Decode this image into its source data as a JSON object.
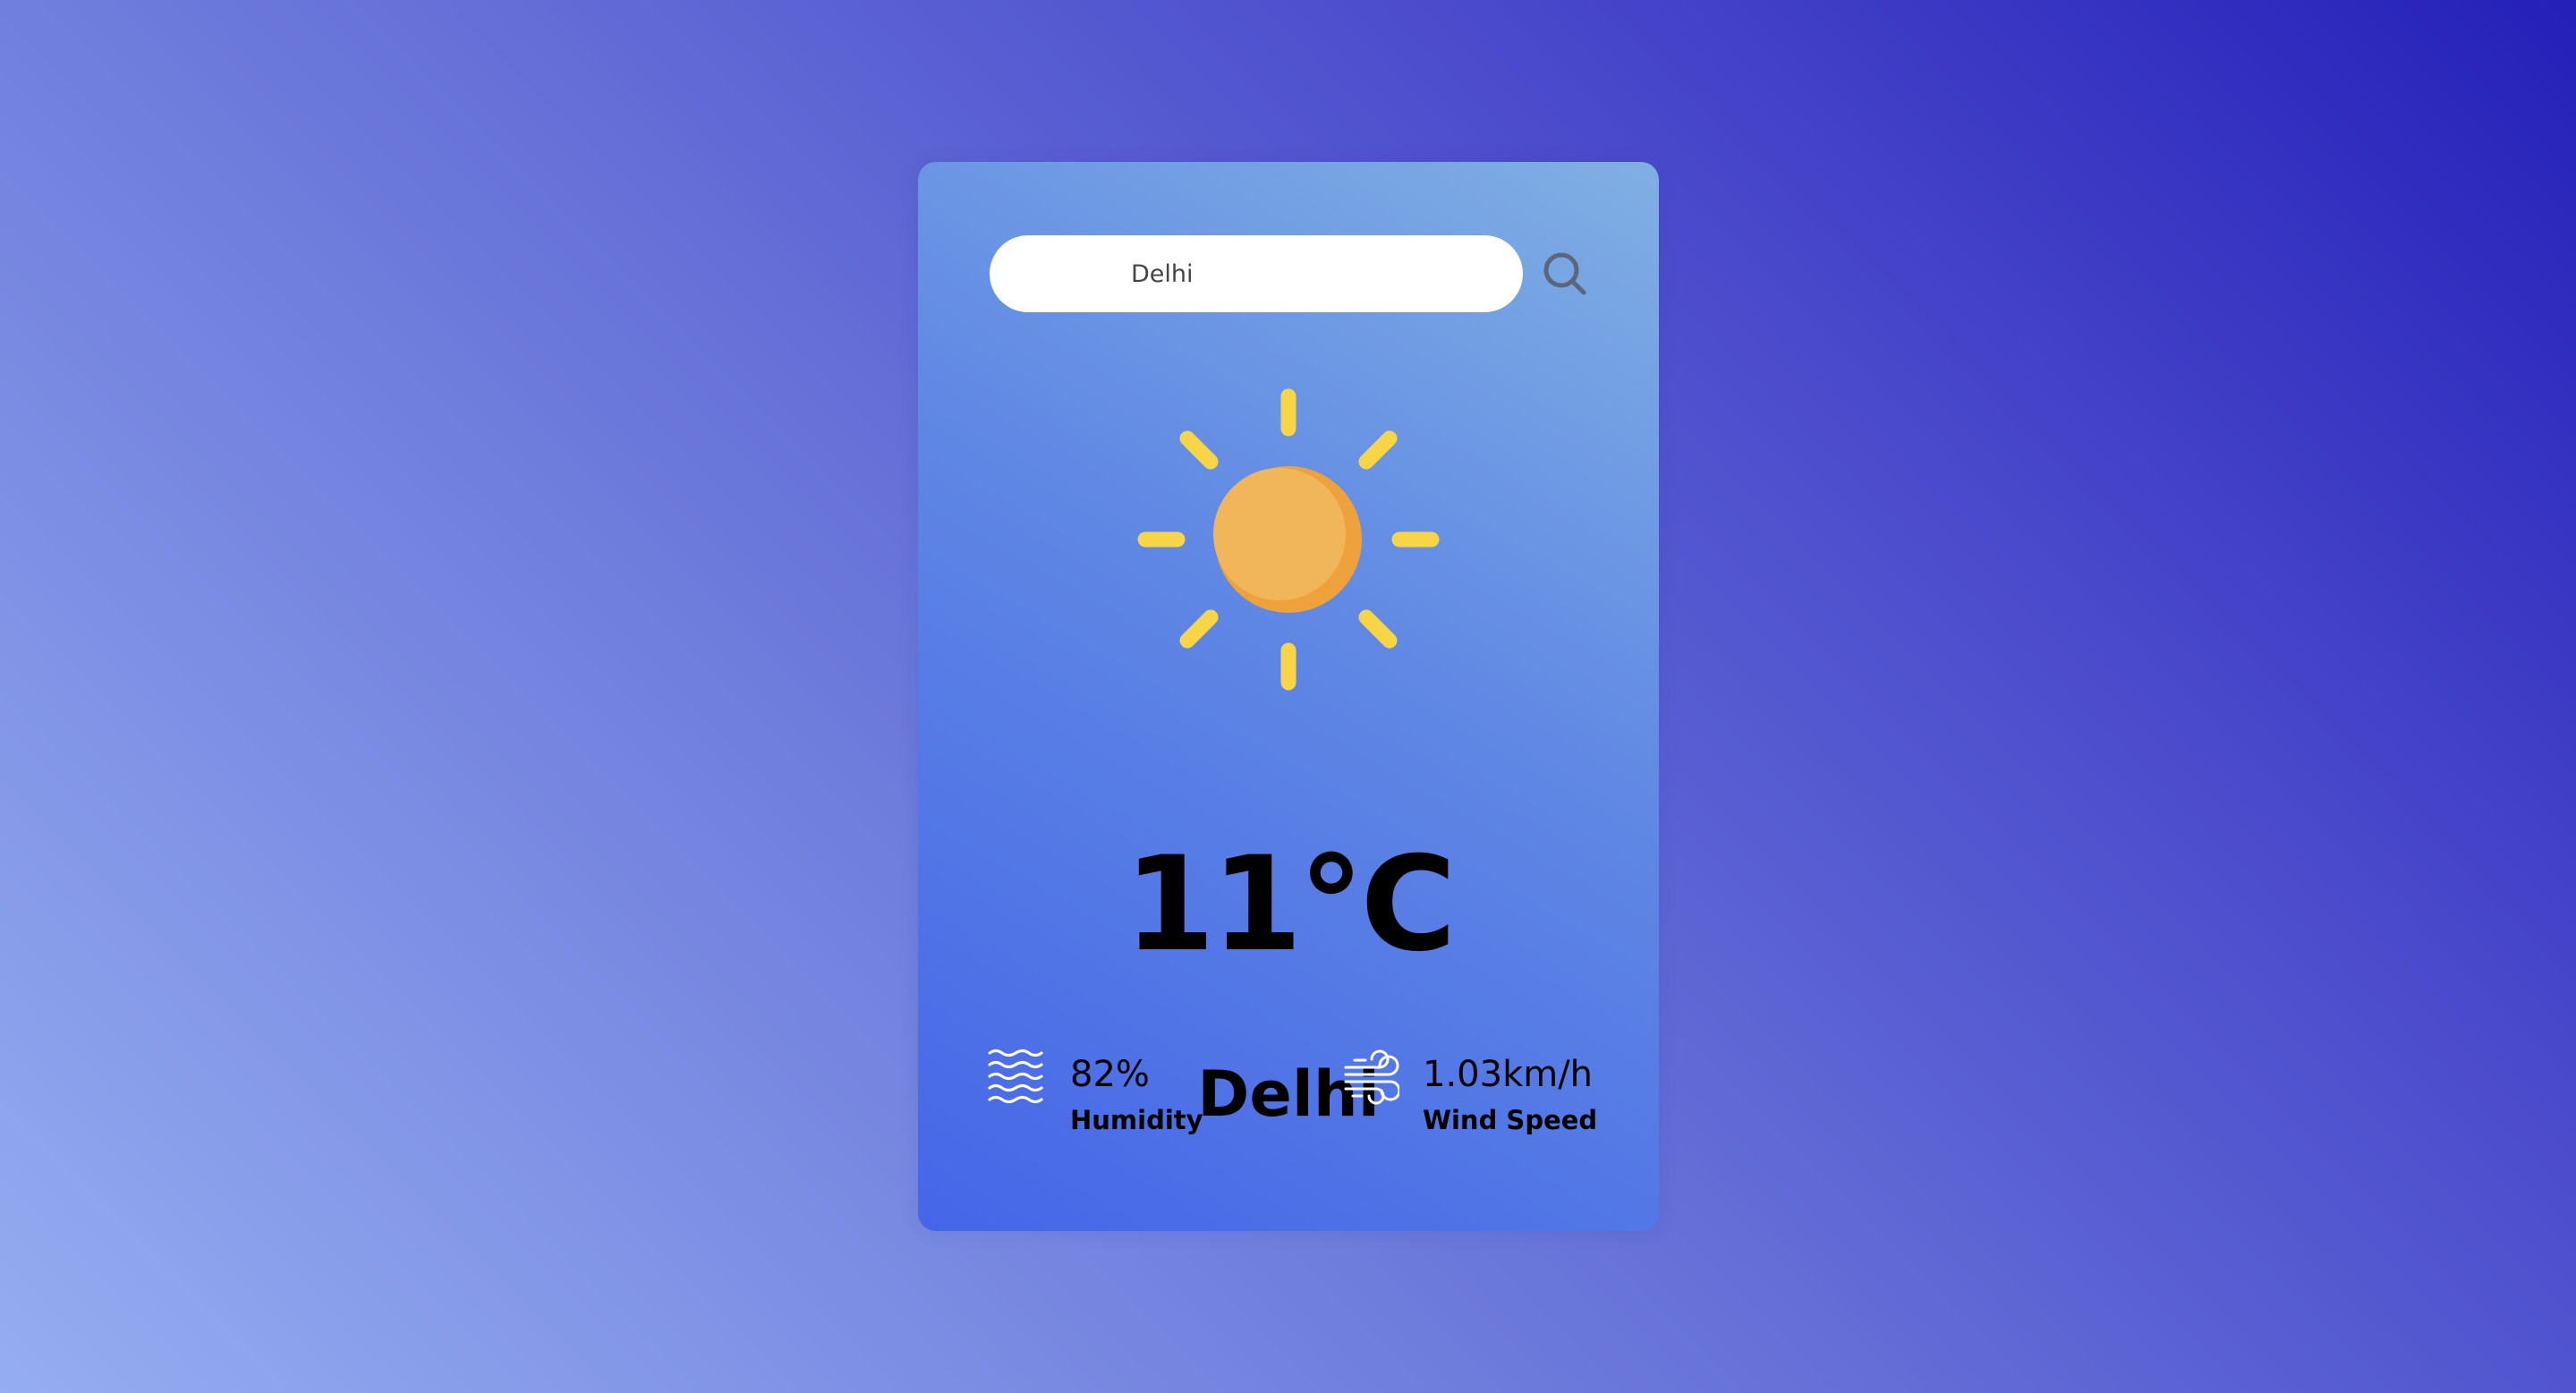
{
  "search": {
    "value": "Delhi",
    "button_icon": "search-icon"
  },
  "weather": {
    "icon": "sun-icon",
    "temperature": "11°C",
    "city": "Delhi"
  },
  "details": {
    "humidity": {
      "icon": "humidity-icon",
      "value": "82%",
      "label": "Humidity"
    },
    "wind": {
      "icon": "wind-icon",
      "value": "1.03km/h",
      "label": "Wind Speed"
    }
  },
  "colors": {
    "background_light": "#95adf1",
    "background_dark": "#2420b8",
    "card_start": "#4566e8",
    "card_end": "#80afe3",
    "sun": "#f1b65a",
    "sun_shade": "#eea23c",
    "sun_rays": "#f7d547",
    "text": "#000000"
  }
}
